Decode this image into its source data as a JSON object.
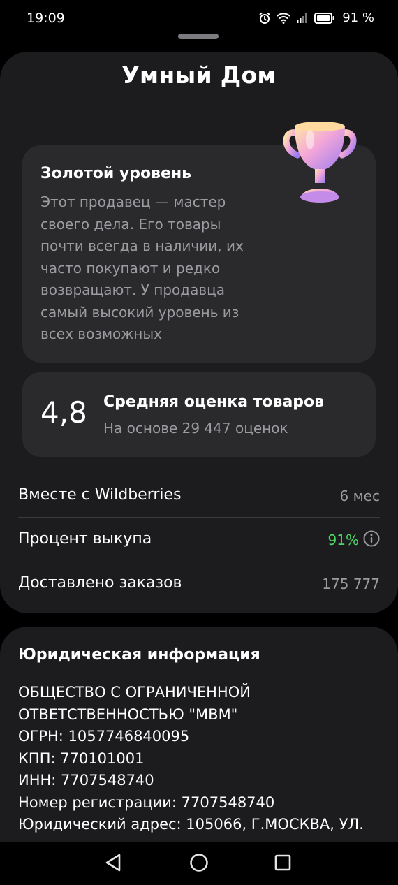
{
  "status_bar": {
    "time": "19:09",
    "battery_percent": "91 %",
    "icons": [
      "alarm-icon",
      "wifi-icon",
      "signal-icon",
      "battery-icon"
    ]
  },
  "sheet": {
    "title": "Умный Дом"
  },
  "level": {
    "title": "Золотой уровень",
    "description_lines": [
      "Этот продавец — мастер",
      "своего дела. Его товары",
      "почти всегда в наличии, их",
      "часто покупают и редко",
      "возвращают. У продавца",
      "самый высокий уровень из",
      "всех возможных"
    ],
    "icon": "trophy-icon"
  },
  "rating": {
    "value": "4,8",
    "title": "Средняя оценка товаров",
    "subtitle": "На основе 29 447 оценок"
  },
  "stats": [
    {
      "label": "Вместе с Wildberries",
      "value": "6 мес"
    },
    {
      "label": "Процент выкупа",
      "value": "91%",
      "color": "#4bd964",
      "icon": "info-icon"
    },
    {
      "label": "Доставлено заказов",
      "value": "175 777"
    }
  ],
  "legal": {
    "title": "Юридическая информация",
    "lines": [
      "ОБЩЕСТВО С ОГРАНИЧЕННОЙ",
      "ОТВЕТСТВЕННОСТЬЮ \"МВМ\"",
      "ОГРН: 1057746840095",
      "КПП: 770101001",
      "ИНН: 7707548740",
      "Номер регистрации: 7707548740",
      "Юридический адрес: 105066, Г.МОСКВА, УЛ."
    ]
  },
  "nav_bar": {
    "buttons": [
      "back-icon",
      "home-icon",
      "recents-icon"
    ]
  },
  "colors": {
    "background": "#000000",
    "sheet": "#1c1c1e",
    "card": "#2a2a2c",
    "secondary_text": "#9b9ba0",
    "accent_green": "#4bd964"
  }
}
